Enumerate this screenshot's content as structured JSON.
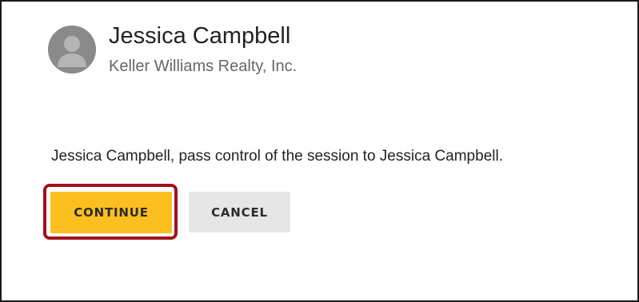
{
  "user": {
    "name": "Jessica Campbell",
    "organization": "Keller Williams Realty, Inc.",
    "avatar_icon": "default-user-avatar-icon"
  },
  "message": "Jessica Campbell, pass control of the session to Jessica Campbell.",
  "actions": {
    "continue_label": "CONTINUE",
    "cancel_label": "CANCEL"
  },
  "colors": {
    "continue_button": "#fbc020",
    "cancel_button": "#e6e6e6",
    "highlight_outline": "#a0131c",
    "avatar_background": "#8a8a8a"
  }
}
